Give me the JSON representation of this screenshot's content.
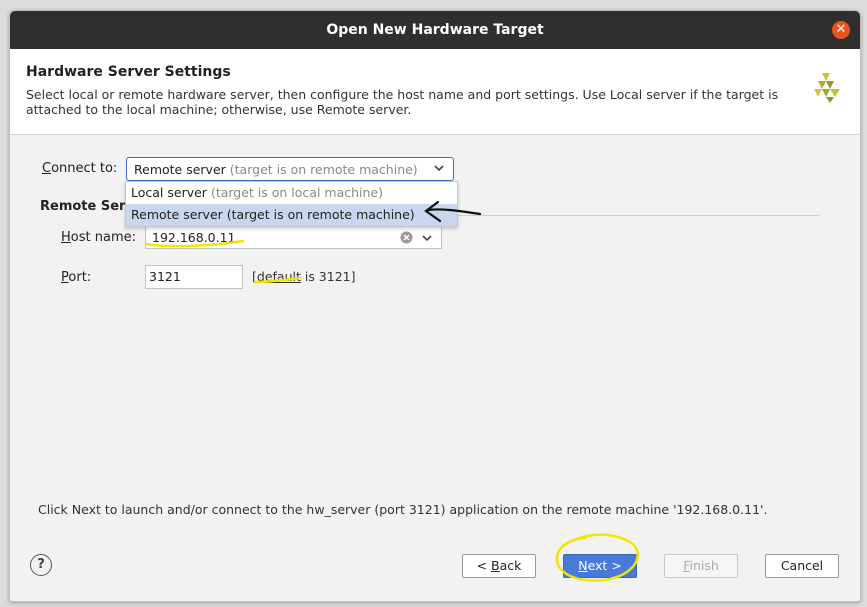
{
  "window": {
    "title": "Open New Hardware Target"
  },
  "header": {
    "title": "Hardware Server Settings",
    "description": "Select local or remote hardware server, then configure the host name and port settings. Use Local server if the target is attached to the local machine; otherwise, use Remote server."
  },
  "connect": {
    "label": "Connect to:",
    "selected_main": "Remote server",
    "selected_hint": "(target is on remote machine)",
    "options": [
      {
        "main": "Local server",
        "hint": "(target is on local machine)"
      },
      {
        "main": "Remote server",
        "hint": "(target is on remote machine)"
      }
    ]
  },
  "remote": {
    "section_title": "Remote Serv",
    "host_label": "Host name:",
    "host_value": "192.168.0.11",
    "port_label": "Port:",
    "port_value": "3121",
    "port_hint_open": "[",
    "port_hint_default": "default",
    "port_hint_rest": " is 3121]"
  },
  "footer": {
    "message": "Click Next to launch and/or connect to the hw_server (port 3121) application on the remote machine '192.168.0.11'."
  },
  "buttons": {
    "help": "?",
    "back_prefix": "< ",
    "back_mnemonic": "B",
    "back_rest": "ack",
    "next_mnemonic": "N",
    "next_rest": "ext >",
    "finish_mnemonic": "F",
    "finish_rest": "inish",
    "cancel": "Cancel"
  },
  "colors": {
    "titlebar": "#2f2f2f",
    "close": "#e95420",
    "primary": "#4a7ad8",
    "annotation": "#f2e600"
  }
}
